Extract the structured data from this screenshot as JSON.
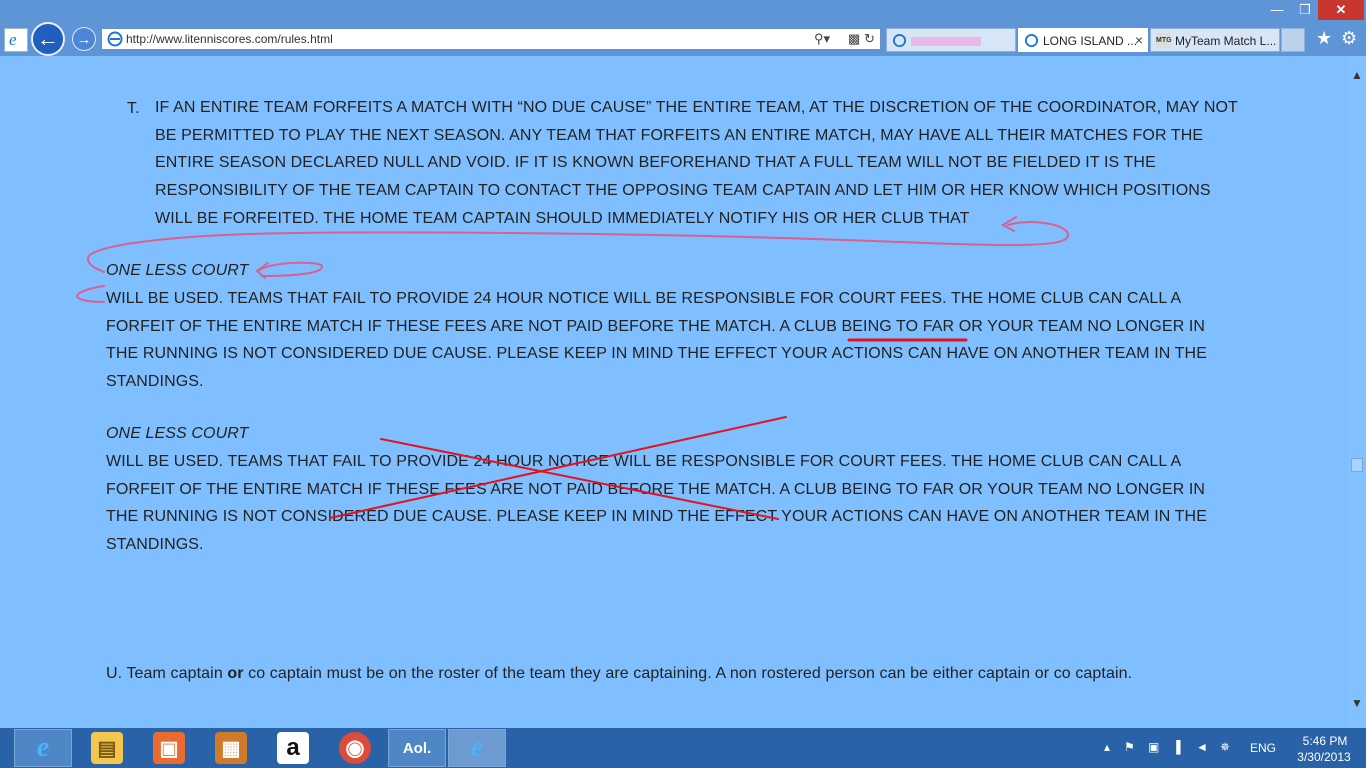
{
  "browser": {
    "url": "http://www.litenniscores.com/rules.html",
    "back_label": "←",
    "forward_label": "→",
    "tabs": [
      {
        "label": "",
        "active": false
      },
      {
        "label": "LONG ISLAND ...",
        "active": true
      },
      {
        "label": "MyTeam Match L...",
        "active": false,
        "icon_text": "MTG"
      }
    ],
    "close_label": "×",
    "window_controls": {
      "minimize": "―",
      "restore": "❐",
      "close": "✕"
    },
    "favorites_icon": "★",
    "tools_icon": "⚙"
  },
  "page": {
    "rule_t": {
      "marker": "T.",
      "text": "IF AN ENTIRE TEAM FORFEITS A MATCH WITH “NO DUE CAUSE” THE ENTIRE TEAM, AT THE DISCRETION OF THE COORDINATOR, MAY NOT BE PERMITTED TO PLAY THE NEXT SEASON.   ANY TEAM THAT FORFEITS AN ENTIRE MATCH, MAY HAVE ALL THEIR MATCHES FOR THE ENTIRE SEASON DECLARED NULL AND VOID. IF IT IS KNOWN BEFOREHAND THAT A FULL TEAM WILL NOT BE FIELDED IT IS THE RESPONSIBILITY OF THE TEAM CAPTAIN TO CONTACT THE OPPOSING TEAM CAPTAIN AND LET HIM OR HER KNOW WHICH POSITIONS WILL BE FORFEITED.  THE HOME TEAM CAPTAIN SHOULD IMMEDIATELY NOTIFY HIS OR HER CLUB THAT"
    },
    "para1": {
      "heading": "ONE LESS COURT",
      "body": "WILL BE USED.  TEAMS THAT FAIL TO PROVIDE 24 HOUR NOTICE WILL BE RESPONSIBLE FOR COURT FEES.  THE HOME CLUB CAN CALL A FORFEIT OF THE ENTIRE MATCH IF THESE FEES ARE NOT PAID BEFORE THE MATCH.  A CLUB BEING TO FAR OR YOUR TEAM NO LONGER IN THE RUNNING IS NOT CONSIDERED DUE CAUSE.  PLEASE KEEP IN MIND THE EFFECT YOUR ACTIONS CAN HAVE ON ANOTHER TEAM IN THE STANDINGS."
    },
    "para2": {
      "heading": "ONE LESS COURT",
      "body": "WILL BE USED.  TEAMS THAT FAIL TO PROVIDE 24 HOUR NOTICE WILL BE RESPONSIBLE FOR COURT FEES.  THE HOME CLUB CAN CALL A FORFEIT OF THE ENTIRE MATCH IF THESE FEES ARE NOT PAID BEFORE THE MATCH.  A CLUB BEING TO FAR OR YOUR TEAM NO LONGER IN THE RUNNING IS NOT CONSIDERED DUE CAUSE.  PLEASE KEEP IN MIND THE EFFECT YOUR ACTIONS CAN HAVE ON ANOTHER TEAM IN THE STANDINGS."
    },
    "rule_u": {
      "prefix": "U.  Team captain ",
      "bold": "or",
      "suffix": " co captain must be on the roster of the team they are captaining.  A non rostered person can be either captain or co captain."
    }
  },
  "annotations": {
    "pink_color": "#d9608f",
    "red_color": "#e0141e"
  },
  "taskbar": {
    "apps": [
      {
        "name": "Internet Explorer",
        "glyph": "e"
      },
      {
        "name": "File Explorer",
        "glyph": "▤"
      },
      {
        "name": "Photo app",
        "glyph": "▣"
      },
      {
        "name": "Media app",
        "glyph": "▦"
      },
      {
        "name": "Amazon",
        "glyph": "a"
      },
      {
        "name": "Chrome",
        "glyph": "◉"
      },
      {
        "name": "AOL",
        "glyph": "Aol."
      },
      {
        "name": "Internet Explorer window",
        "glyph": "e"
      }
    ],
    "tray_icons": [
      "▴",
      "⚑",
      "▣",
      "▐",
      "◄",
      "✵"
    ],
    "language": "ENG",
    "time": "5:46 PM",
    "date": "3/30/2013"
  }
}
